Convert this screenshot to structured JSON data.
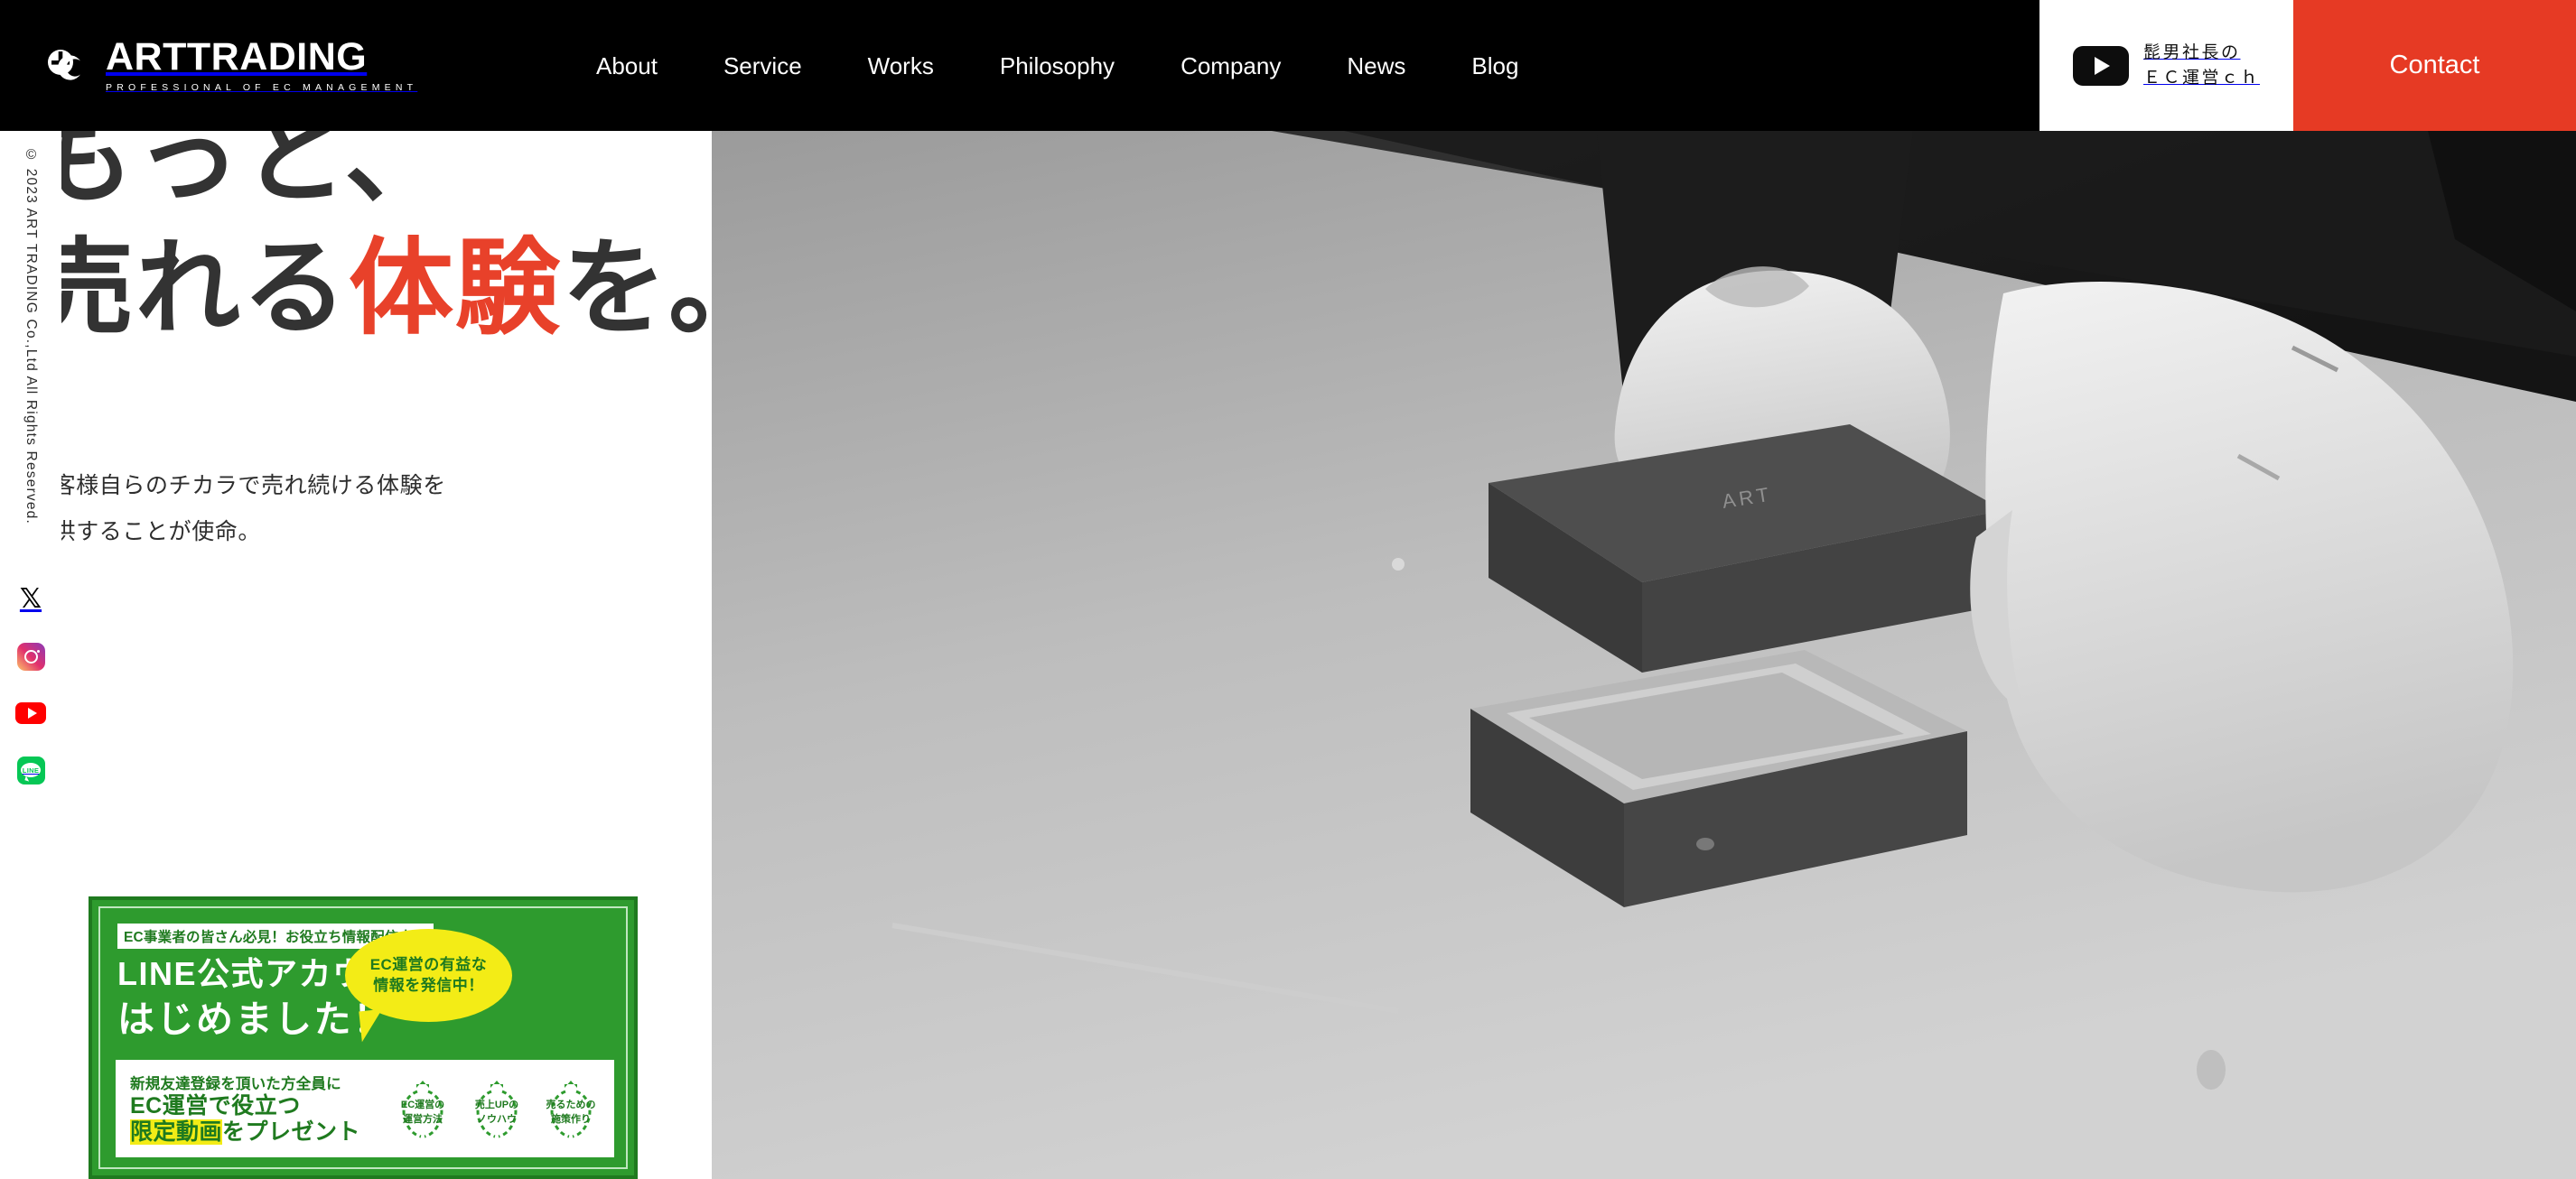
{
  "header": {
    "logo": {
      "word": "ARTTRADING",
      "tagline": "PROFESSIONAL OF EC MANAGEMENT",
      "icon": "arttrading-logo-mark"
    },
    "nav": [
      {
        "label": "About"
      },
      {
        "label": "Service"
      },
      {
        "label": "Works"
      },
      {
        "label": "Philosophy"
      },
      {
        "label": "Company"
      },
      {
        "label": "News"
      },
      {
        "label": "Blog"
      }
    ],
    "youtube": {
      "icon": "youtube-play-icon",
      "line1": "髭男社長の",
      "line2": "ＥＣ運営ｃｈ"
    },
    "contact": {
      "label": "Contact",
      "color": "#e63a24"
    }
  },
  "sidebar": {
    "copyright": "© 2023 ART TRADING Co.,Ltd All Rights Reserved.",
    "socials": [
      {
        "name": "x-icon",
        "glyph": "𝕏",
        "color": "#000000"
      },
      {
        "name": "instagram-icon",
        "color": "#e1306c"
      },
      {
        "name": "youtube-icon",
        "color": "#ff0000"
      },
      {
        "name": "line-icon",
        "label": "LINE",
        "color": "#06c755"
      }
    ]
  },
  "hero": {
    "headline": {
      "line1": "もっと、",
      "line2_a": "売れる",
      "line2_red": "体験",
      "line2_b": "を。",
      "accent_color": "#e8412a",
      "text_color": "#333333"
    },
    "lead_line1": "お客様自らのチカラで売れ続ける体験を",
    "lead_line2": "提供することが使命。",
    "image_alt": "白手袋の手がギフトボックスを開ける様子（モノクロ写真）"
  },
  "banner": {
    "tag": "EC事業者の皆さん必見！お役立ち情報配信中！",
    "headline1": "LINE公式アカウント",
    "headline2": "はじめました！",
    "bubble_line1": "EC運営の有益な",
    "bubble_line2": "情報を発信中！",
    "card_line1": "新規友達登録を頂いた方全員に",
    "card_line2": "EC運営で役立つ",
    "card_line3_highlight": "限定動画",
    "card_line3_rest": "をプレゼント",
    "badges": [
      {
        "line1": "EC運営の",
        "line2": "運営方法"
      },
      {
        "line1": "売上UPの",
        "line2": "ノウハウ"
      },
      {
        "line1": "売るための",
        "line2": "施策作り"
      }
    ],
    "colors": {
      "bg": "#2e9b2e",
      "bubble": "#f3ec16",
      "text": "#ffffff"
    }
  }
}
